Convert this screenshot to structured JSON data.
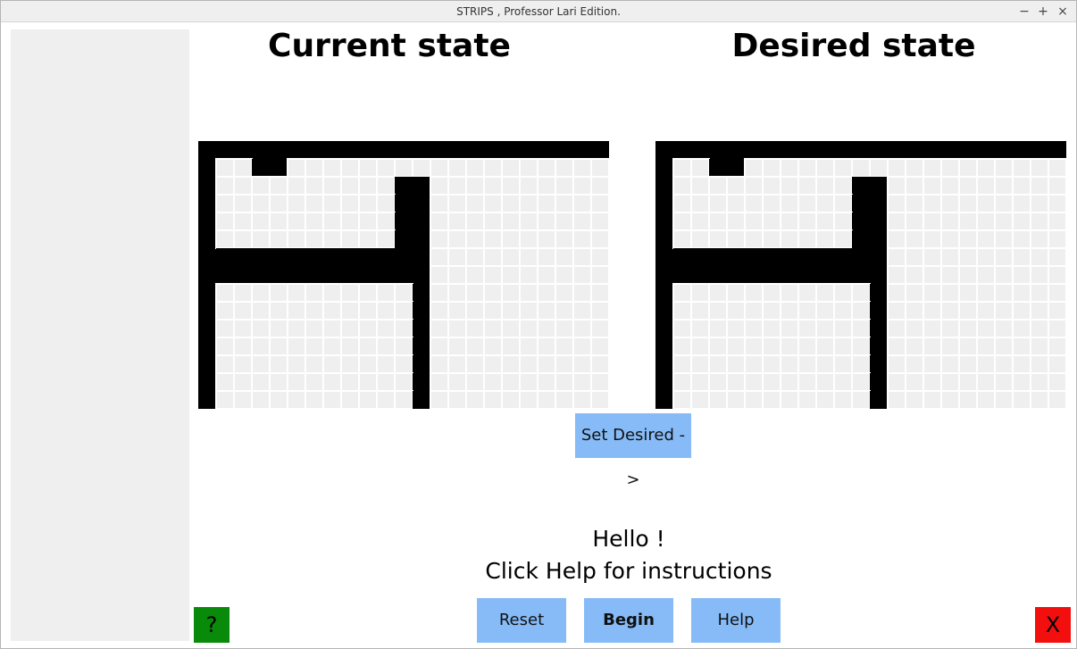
{
  "window": {
    "title": "STRIPS , Professor Lari Edition.",
    "minimize_glyph": "−",
    "maximize_glyph": "+",
    "close_glyph": "×"
  },
  "panels": {
    "current_title": "Current state",
    "desired_title": "Desired state"
  },
  "grid": {
    "cols": 22,
    "rows": 14,
    "wall_color": "#000000",
    "cell_color": "#efefef",
    "line_color": "#ffffff",
    "current_walls": [
      [
        0,
        2
      ],
      [
        0,
        3
      ],
      [
        1,
        10
      ],
      [
        1,
        11
      ],
      [
        2,
        10
      ],
      [
        2,
        11
      ],
      [
        3,
        10
      ],
      [
        3,
        11
      ],
      [
        4,
        10
      ],
      [
        4,
        11
      ],
      [
        5,
        0
      ],
      [
        5,
        1
      ],
      [
        5,
        2
      ],
      [
        5,
        3
      ],
      [
        5,
        4
      ],
      [
        5,
        5
      ],
      [
        5,
        6
      ],
      [
        5,
        7
      ],
      [
        5,
        8
      ],
      [
        5,
        9
      ],
      [
        5,
        10
      ],
      [
        5,
        11
      ],
      [
        6,
        0
      ],
      [
        6,
        1
      ],
      [
        6,
        2
      ],
      [
        6,
        3
      ],
      [
        6,
        4
      ],
      [
        6,
        5
      ],
      [
        6,
        6
      ],
      [
        6,
        7
      ],
      [
        6,
        8
      ],
      [
        6,
        9
      ],
      [
        6,
        10
      ],
      [
        6,
        11
      ],
      [
        7,
        11
      ],
      [
        8,
        11
      ],
      [
        9,
        11
      ],
      [
        10,
        11
      ],
      [
        11,
        11
      ],
      [
        12,
        11
      ],
      [
        13,
        11
      ]
    ],
    "desired_walls": [
      [
        0,
        2
      ],
      [
        0,
        3
      ],
      [
        1,
        10
      ],
      [
        1,
        11
      ],
      [
        2,
        10
      ],
      [
        2,
        11
      ],
      [
        3,
        10
      ],
      [
        3,
        11
      ],
      [
        4,
        10
      ],
      [
        4,
        11
      ],
      [
        5,
        0
      ],
      [
        5,
        1
      ],
      [
        5,
        2
      ],
      [
        5,
        3
      ],
      [
        5,
        4
      ],
      [
        5,
        5
      ],
      [
        5,
        6
      ],
      [
        5,
        7
      ],
      [
        5,
        8
      ],
      [
        5,
        9
      ],
      [
        5,
        10
      ],
      [
        5,
        11
      ],
      [
        6,
        0
      ],
      [
        6,
        1
      ],
      [
        6,
        2
      ],
      [
        6,
        3
      ],
      [
        6,
        4
      ],
      [
        6,
        5
      ],
      [
        6,
        6
      ],
      [
        6,
        7
      ],
      [
        6,
        8
      ],
      [
        6,
        9
      ],
      [
        6,
        10
      ],
      [
        6,
        11
      ],
      [
        7,
        11
      ],
      [
        8,
        11
      ],
      [
        9,
        11
      ],
      [
        10,
        11
      ],
      [
        11,
        11
      ],
      [
        12,
        11
      ],
      [
        13,
        11
      ]
    ]
  },
  "buttons": {
    "set_desired": "Set Desired ->",
    "reset": "Reset",
    "begin": "Begin",
    "help": "Help",
    "help_corner": "?",
    "exit_corner": "X"
  },
  "message": {
    "line1": "Hello !",
    "line2": "Click Help for instructions"
  },
  "colors": {
    "button_blue": "#86bbf7",
    "help_green": "#0a8a0a",
    "exit_red": "#f40f0f",
    "sidebar_gray": "#efefef"
  }
}
